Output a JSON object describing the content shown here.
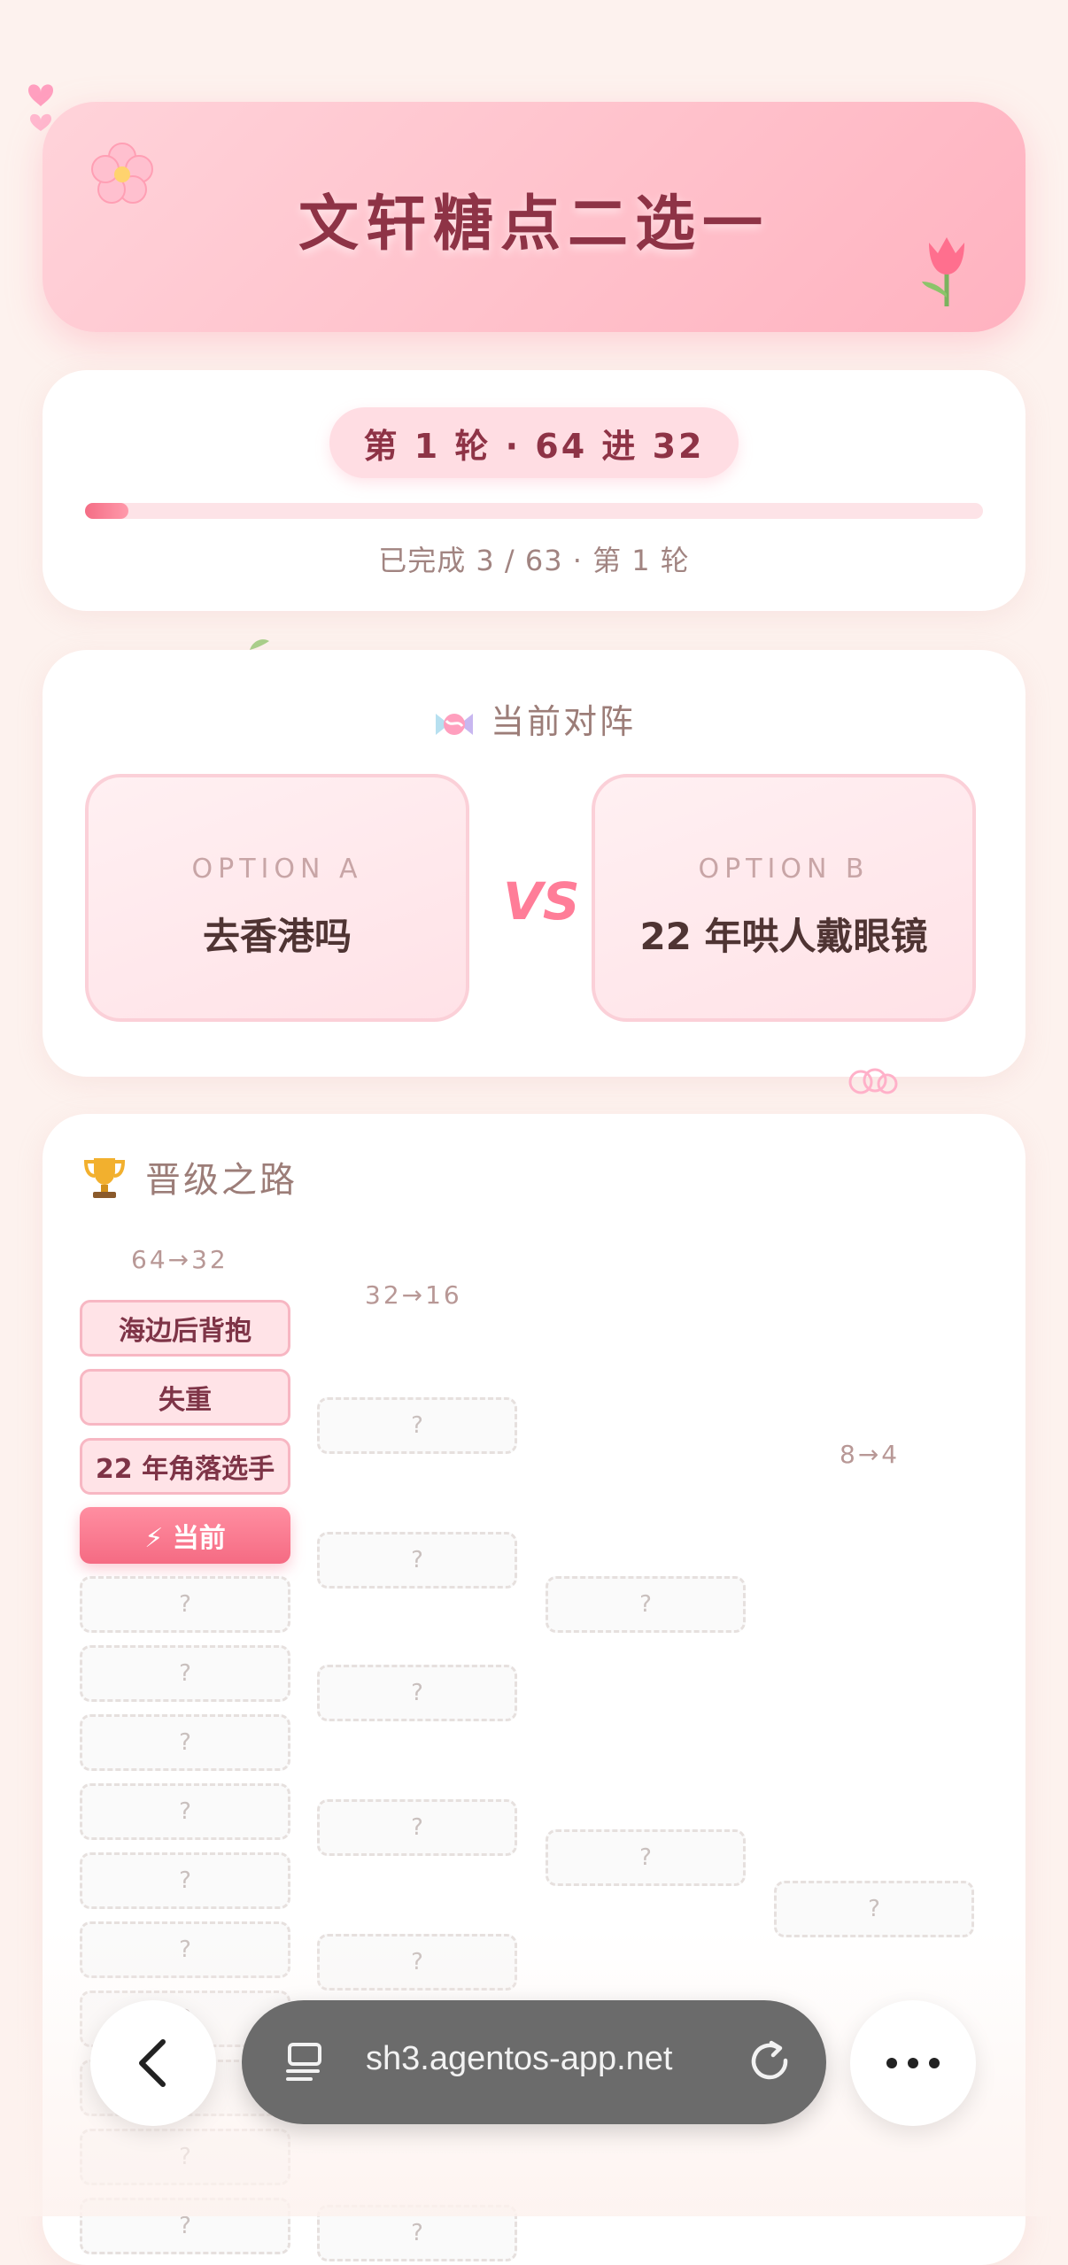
{
  "header": {
    "title": "文轩糖点二选一"
  },
  "round": {
    "pill": "第 1 轮 · 64 进 32",
    "progress_fraction": 0.048,
    "status": "已完成 3 / 63 · 第 1 轮"
  },
  "matchup": {
    "heading": "当前对阵",
    "option_a": {
      "label": "OPTION A",
      "text": "去香港吗"
    },
    "vs": "VS",
    "option_b": {
      "label": "OPTION B",
      "text": "22 年哄人戴眼镜"
    }
  },
  "bracket": {
    "heading": "晋级之路",
    "columns": [
      "64→32",
      "32→16",
      "8→4"
    ],
    "round1": {
      "done": [
        "海边后背抱",
        "失重",
        "22 年角落选手"
      ],
      "current": "⚡ 当前",
      "empty": "?"
    }
  },
  "browser": {
    "url": "sh3.agentos-app.net"
  },
  "colors": {
    "accent": "#f56b83",
    "title": "#8e3346",
    "background": "#fdf2ee",
    "urlbar": "#6b6b6b"
  },
  "icons": {
    "matchup": "candy-icon",
    "bracket": "trophy-icon",
    "title_left": "flower-icon",
    "title_right": "tulip-icon",
    "back": "chevron-left-icon",
    "tabs": "tabs-icon",
    "reload": "reload-icon",
    "more": "more-icon"
  }
}
